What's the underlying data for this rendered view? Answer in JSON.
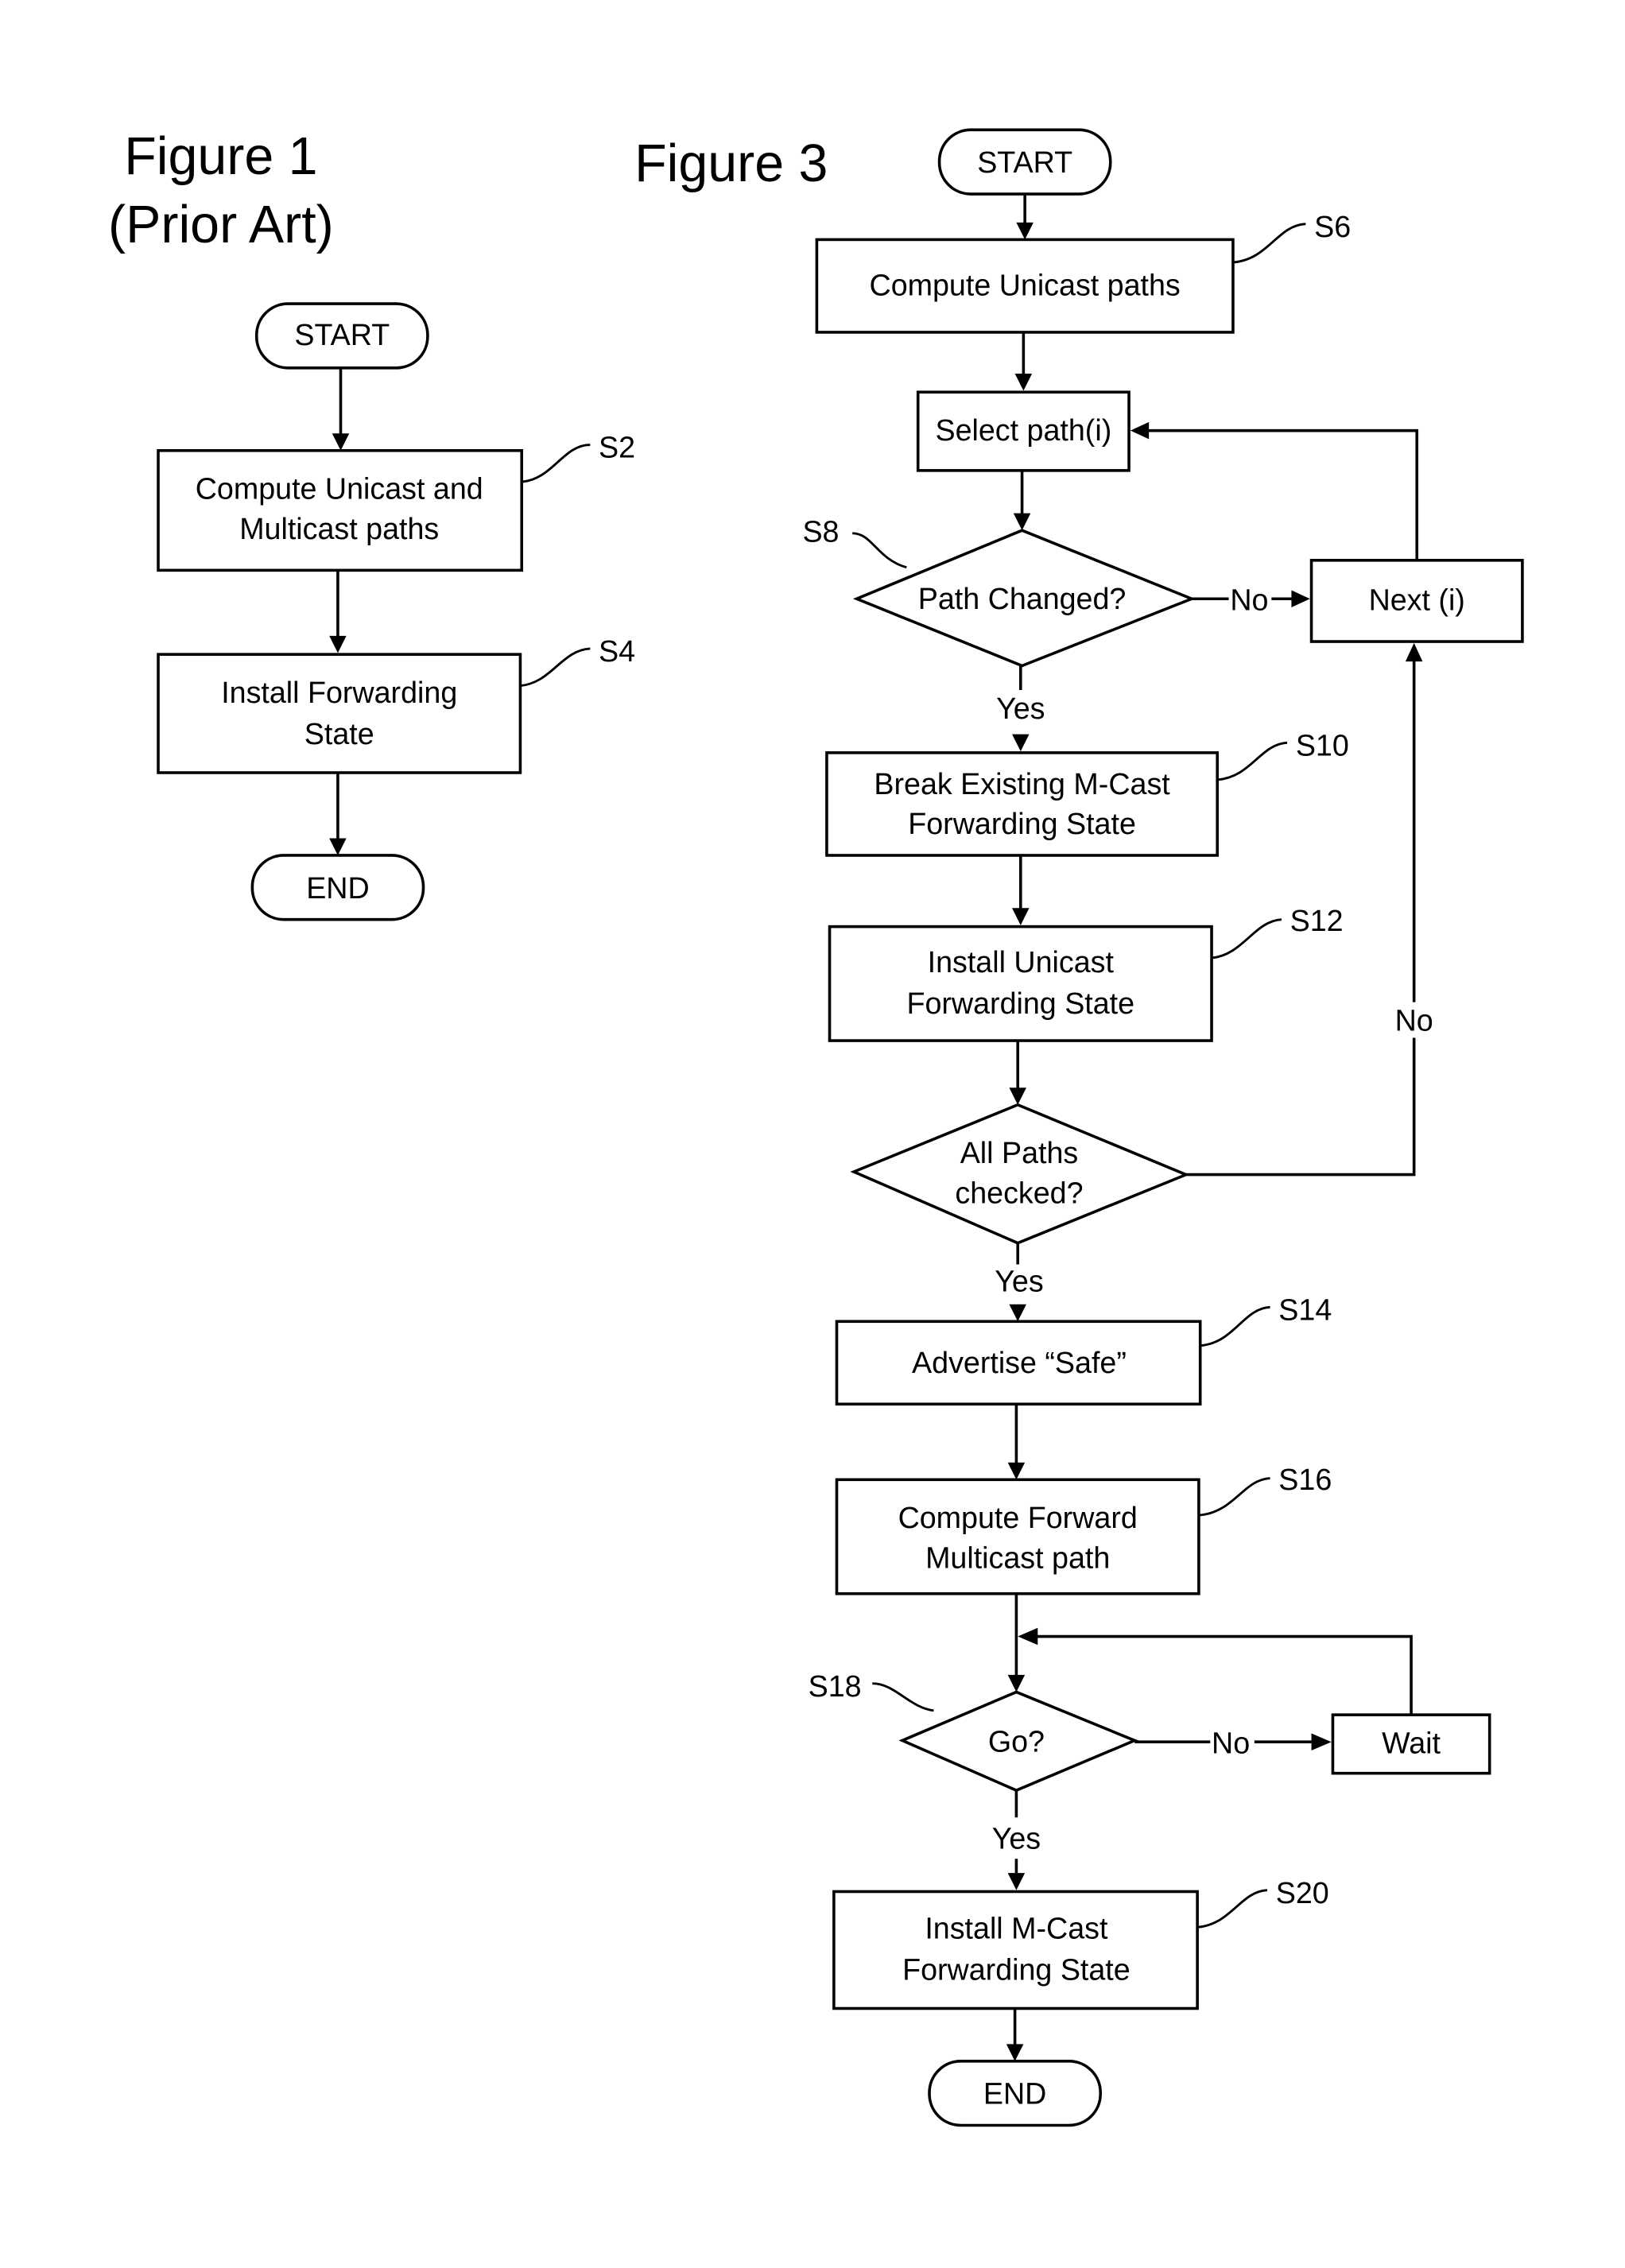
{
  "figure1": {
    "title_line1": "Figure 1",
    "title_line2": "(Prior Art)",
    "start": "START",
    "s2": {
      "line1": "Compute Unicast and",
      "line2": "Multicast paths",
      "ref": "S2"
    },
    "s4": {
      "line1": "Install Forwarding",
      "line2": "State",
      "ref": "S4"
    },
    "end": "END"
  },
  "figure3": {
    "title": "Figure 3",
    "start": "START",
    "s6": {
      "text": "Compute Unicast paths",
      "ref": "S6"
    },
    "select": {
      "text": "Select path(i)"
    },
    "s8": {
      "text": "Path Changed?",
      "ref": "S8",
      "no": "No",
      "yes": "Yes"
    },
    "next": {
      "text": "Next (i)"
    },
    "s10": {
      "line1": "Break Existing  M-Cast",
      "line2": "Forwarding State",
      "ref": "S10"
    },
    "s12": {
      "line1": "Install Unicast",
      "line2": "Forwarding State",
      "ref": "S12"
    },
    "allpaths": {
      "line1": "All Paths",
      "line2": "checked?",
      "no": "No",
      "yes": "Yes"
    },
    "s14": {
      "text": "Advertise “Safe”",
      "ref": "S14"
    },
    "s16": {
      "line1": "Compute Forward",
      "line2": "Multicast path",
      "ref": "S16"
    },
    "s18": {
      "text": "Go?",
      "ref": "S18",
      "no": "No",
      "yes": "Yes"
    },
    "wait": {
      "text": "Wait"
    },
    "s20": {
      "line1": "Install M-Cast",
      "line2": "Forwarding State",
      "ref": "S20"
    },
    "end": "END"
  }
}
